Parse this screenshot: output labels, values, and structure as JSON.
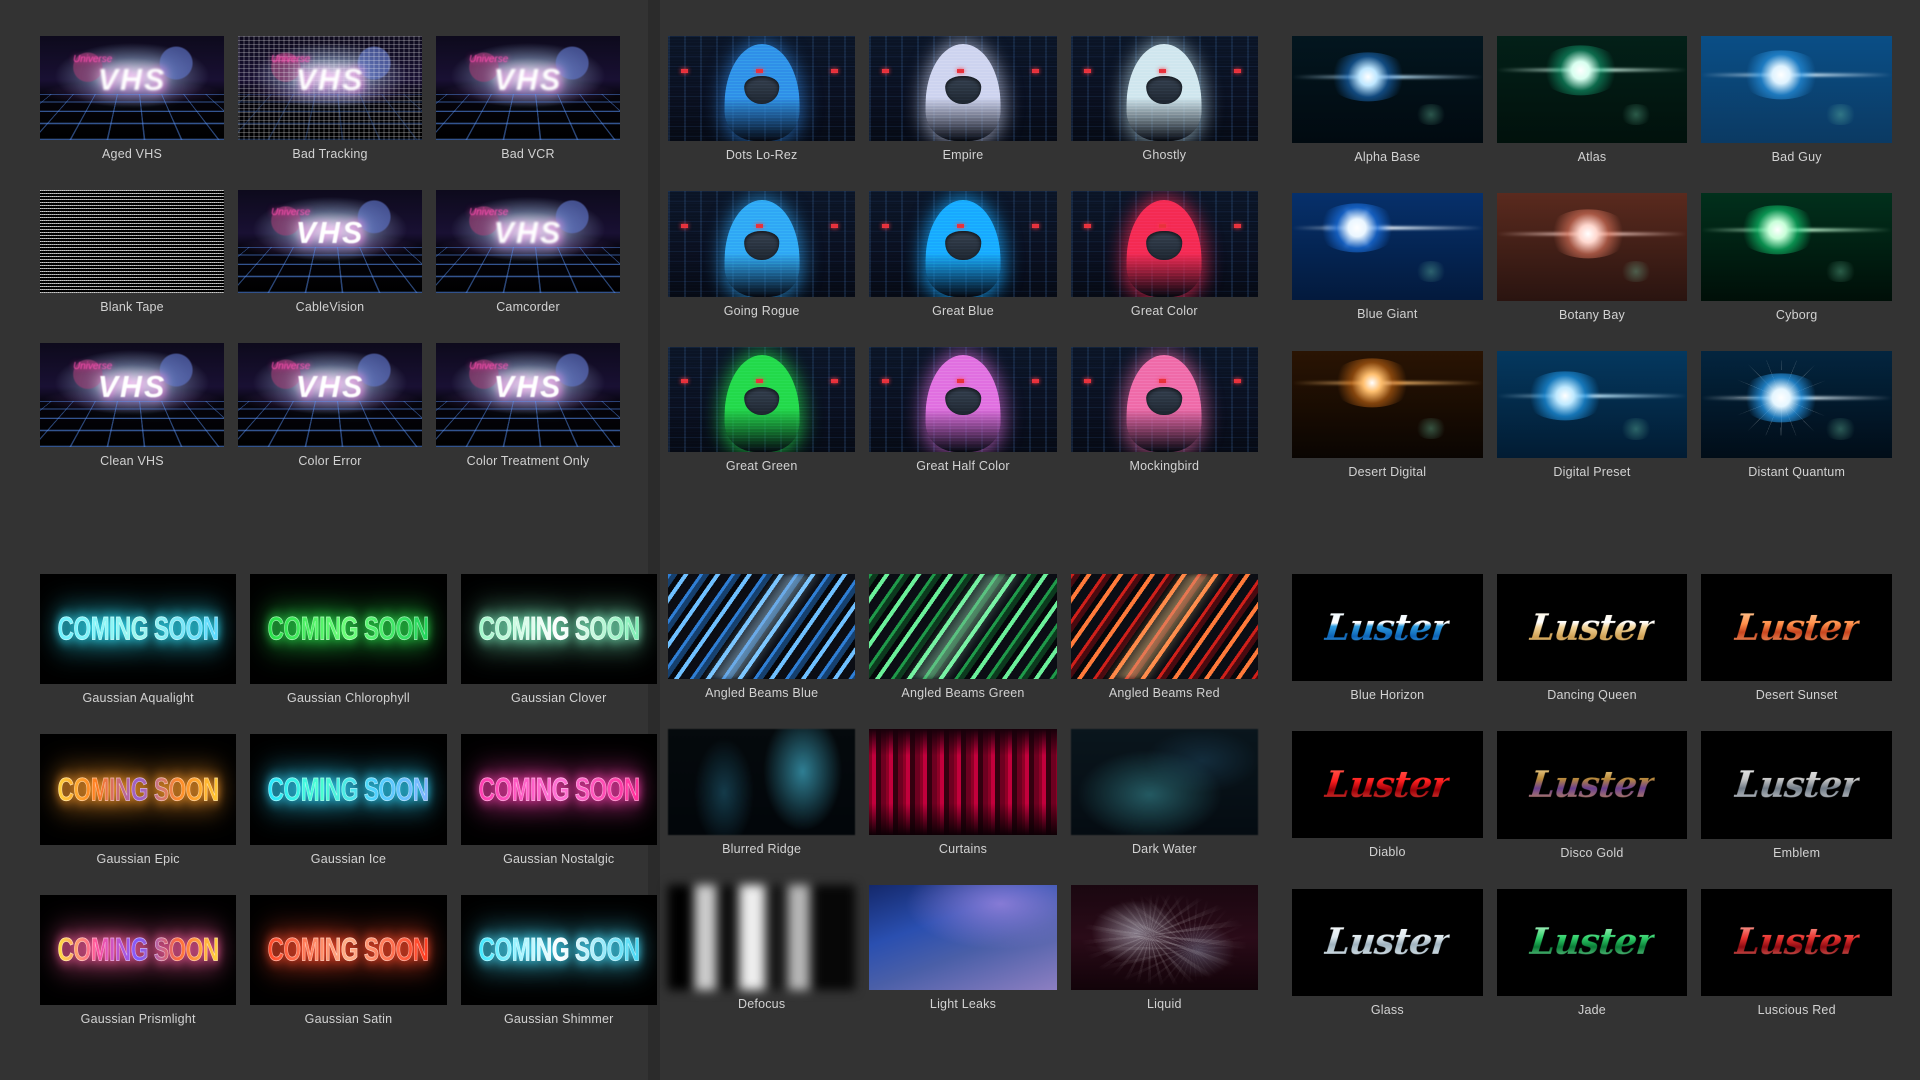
{
  "theme": {
    "app_background": "#2b2b2b",
    "panel_background": "#333333",
    "caption_color": "#d2d2d2",
    "thumbnail_background": "#000000"
  },
  "panels": [
    {
      "id": "vhs-presets",
      "band": "top",
      "column": 1,
      "items": [
        {
          "label": "Aged VHS",
          "art": "vhs",
          "variant": "aged"
        },
        {
          "label": "Bad Tracking",
          "art": "vhs",
          "variant": "tracking"
        },
        {
          "label": "Bad VCR",
          "art": "vhs",
          "variant": "badvcr"
        },
        {
          "label": "Blank Tape",
          "art": "vhs",
          "variant": "blank"
        },
        {
          "label": "CableVision",
          "art": "vhs",
          "variant": "cable"
        },
        {
          "label": "Camcorder",
          "art": "vhs",
          "variant": "camcorder"
        },
        {
          "label": "Clean VHS",
          "art": "vhs",
          "variant": "clean"
        },
        {
          "label": "Color Error",
          "art": "vhs",
          "variant": "colorerror"
        },
        {
          "label": "Color Treatment Only",
          "art": "vhs",
          "variant": "colortreat"
        }
      ]
    },
    {
      "id": "scifi-looks",
      "band": "top",
      "column": 2,
      "items": [
        {
          "label": "Dots Lo-Rez",
          "art": "scifi",
          "fg": "#2f8fe8",
          "glow": "rgba(50,140,235,0.55)"
        },
        {
          "label": "Empire",
          "art": "scifi",
          "fg": "#cdd3ef",
          "glow": "rgba(205,211,239,0.60)"
        },
        {
          "label": "Ghostly",
          "art": "scifi",
          "fg": "#cfe6ee",
          "glow": "rgba(200,235,245,0.55)"
        },
        {
          "label": "Going Rogue",
          "art": "scifi",
          "fg": "#2fa7f5",
          "glow": "rgba(47,167,245,0.60)"
        },
        {
          "label": "Great Blue",
          "art": "scifi",
          "fg": "#18a9ff",
          "glow": "rgba(24,169,255,0.70)"
        },
        {
          "label": "Great Color",
          "art": "scifi",
          "fg": "#f42a52",
          "glow": "rgba(244,42,82,0.65)"
        },
        {
          "label": "Great Green",
          "art": "scifi",
          "fg": "#23d94a",
          "glow": "rgba(35,217,74,0.65)"
        },
        {
          "label": "Great Half Color",
          "art": "scifi",
          "fg": "#e06fe0",
          "glow": "rgba(224,111,224,0.60)"
        },
        {
          "label": "Mockingbird",
          "art": "scifi",
          "fg": "#ef6aa8",
          "glow": "rgba(239,106,168,0.60)"
        }
      ]
    },
    {
      "id": "lens-flares",
      "band": "top",
      "column": 3,
      "items": [
        {
          "label": "Alpha Base",
          "art": "flare",
          "style": "soft",
          "c1": "#bfe7ff",
          "c2": "rgba(30,120,210,0.55)",
          "fx": "40%",
          "fy": "38%",
          "bg": "linear-gradient(#03161f,#010a10)"
        },
        {
          "label": "Atlas",
          "art": "flare",
          "style": "soft",
          "c1": "#d9fff0",
          "c2": "rgba(20,170,120,0.55)",
          "fx": "44%",
          "fy": "32%",
          "bg": "linear-gradient(#032018,#01110c)"
        },
        {
          "label": "Bad Guy",
          "art": "flare",
          "style": "soft",
          "c1": "#dff3ff",
          "c2": "rgba(40,150,230,0.65)",
          "fx": "42%",
          "fy": "36%",
          "bg": "linear-gradient(#0a4e86,#0b3a63)"
        },
        {
          "label": "Blue Giant",
          "art": "flare",
          "style": "star",
          "c1": "#eaf6ff",
          "c2": "rgba(25,110,220,0.75)",
          "fx": "34%",
          "fy": "32%",
          "bg": "linear-gradient(#06306b,#031a3d)"
        },
        {
          "label": "Botany Bay",
          "art": "flare",
          "style": "soft",
          "c1": "#ffd8cf",
          "c2": "rgba(225,120,95,0.60)",
          "fx": "48%",
          "fy": "38%",
          "bg": "linear-gradient(#5a2a1e,#2a1410)"
        },
        {
          "label": "Cyborg",
          "art": "flare",
          "style": "soft",
          "c1": "#c8ffd9",
          "c2": "rgba(15,200,110,0.65)",
          "fx": "40%",
          "fy": "34%",
          "bg": "linear-gradient(#01301c,#000f08)"
        },
        {
          "label": "Desert Digital",
          "art": "flare",
          "style": "soft",
          "c1": "#ffc070",
          "c2": "rgba(200,105,20,0.60)",
          "fx": "42%",
          "fy": "30%",
          "bg": "linear-gradient(#2a1403,#0a0502)"
        },
        {
          "label": "Digital Preset",
          "art": "flare",
          "style": "soft",
          "c1": "#bfe9ff",
          "c2": "rgba(30,150,230,0.70)",
          "fx": "36%",
          "fy": "42%",
          "bg": "linear-gradient(#04385f,#021c33)"
        },
        {
          "label": "Distant Quantum",
          "art": "flare",
          "style": "rays",
          "c1": "#e5f6ff",
          "c2": "rgba(40,160,245,0.70)",
          "fx": "42%",
          "fy": "44%",
          "bg": "linear-gradient(#03253f,#010d18)"
        }
      ]
    },
    {
      "id": "gaussian-text-looks",
      "band": "bottom",
      "column": 1,
      "sample_text": "COMING SOON",
      "items": [
        {
          "label": "Gaussian Aqualight",
          "art": "neon",
          "gradient": "linear-gradient(90deg,#6ef2ff,#9ef8f0,#5bd9ff)",
          "glow": "#2fe6ff"
        },
        {
          "label": "Gaussian Chlorophyll",
          "art": "neon",
          "gradient": "linear-gradient(90deg,#28e04a,#6dff7a,#1fd45a)",
          "glow": "#2ae24d"
        },
        {
          "label": "Gaussian Clover",
          "art": "neon",
          "gradient": "linear-gradient(90deg,#9ff7c9,#ffffff,#7df0b4)",
          "glow": "#7df0c0"
        },
        {
          "label": "Gaussian Epic",
          "art": "neon",
          "gradient": "linear-gradient(90deg,#ffd23d,#ff7a1f,#9a5fd0,#ff8a2a,#ffc832)",
          "glow": "#ff9b2a"
        },
        {
          "label": "Gaussian Ice",
          "art": "neon",
          "gradient": "linear-gradient(90deg,#29e6ff,#4affd0,#4fd2ff,#7fb4ff)",
          "glow": "#2fd8ff"
        },
        {
          "label": "Gaussian Nostalgic",
          "art": "neon",
          "gradient": "linear-gradient(90deg,#ff3fb0,#ff74d6,#ff2f9a)",
          "glow": "#ff3fb0"
        },
        {
          "label": "Gaussian Prismlight",
          "art": "neon",
          "gradient": "linear-gradient(90deg,#ffe23d,#ff4fa0,#7f5bff,#ff6a3d,#ffd23d)",
          "glow": "#ff5fa0"
        },
        {
          "label": "Gaussian Satin",
          "art": "neon",
          "gradient": "linear-gradient(90deg,#ff4a2a,#ffb08a,#ff3b1f)",
          "glow": "#ff4a2a"
        },
        {
          "label": "Gaussian Shimmer",
          "art": "neon",
          "gradient": "linear-gradient(90deg,#3fe8ff,#ffffff,#46d9f5)",
          "glow": "#46e0ff"
        }
      ]
    },
    {
      "id": "backgrounds-textures",
      "band": "bottom",
      "column": 2,
      "items": [
        {
          "label": "Angled Beams Blue",
          "art": "beams",
          "b1": "#2f7fd6",
          "b2": "#16406e",
          "b3": "#6fc0ff",
          "hot": "rgba(180,225,255,0.5)"
        },
        {
          "label": "Angled Beams Green",
          "art": "beams",
          "b1": "#1f9a4a",
          "b2": "#0c3a1e",
          "b3": "#6bf09a",
          "hot": "rgba(180,255,210,0.45)"
        },
        {
          "label": "Angled Beams Red",
          "art": "beams",
          "b1": "#d0201a",
          "b2": "#4a0a10",
          "b3": "#ff7a3a",
          "hot": "rgba(255,210,140,0.55)"
        },
        {
          "label": "Blurred Ridge",
          "art": "blurred-ridge"
        },
        {
          "label": "Curtains",
          "art": "curtains"
        },
        {
          "label": "Dark Water",
          "art": "dark-water"
        },
        {
          "label": "Defocus",
          "art": "defocus"
        },
        {
          "label": "Light Leaks",
          "art": "light-leaks"
        },
        {
          "label": "Liquid",
          "art": "liquid"
        }
      ]
    },
    {
      "id": "luster-title-styles",
      "band": "bottom",
      "column": 3,
      "sample_text": "Luster",
      "items": [
        {
          "label": "Blue Horizon",
          "art": "luster",
          "gradient": "linear-gradient(180deg,#e8f7ff 0%,#ffffff 38%,#2f9de0 46%,#0d63b6 70%,#5fc2ff 100%)"
        },
        {
          "label": "Dancing Queen",
          "art": "luster",
          "gradient": "linear-gradient(180deg,#fff4dc 0%,#ffffff 36%,#f2d49a 48%,#cf9f52 72%,#ffe9bd 100%)"
        },
        {
          "label": "Desert Sunset",
          "art": "luster",
          "gradient": "linear-gradient(180deg,#ffd7a8 0%,#ff8f4a 40%,#c7451f 60%,#ffb177 100%)"
        },
        {
          "label": "Diablo",
          "art": "luster",
          "gradient": "linear-gradient(180deg,#ff6a5a 0%,#ff1f1f 40%,#9a0008 62%,#ff5a4a 100%)"
        },
        {
          "label": "Disco Gold",
          "art": "luster",
          "gradient": "linear-gradient(180deg,#ffe7a8 0%,#b98a3a 35%,#6a3f8f 58%,#e0a84a 100%)"
        },
        {
          "label": "Emblem",
          "art": "luster",
          "gradient": "linear-gradient(180deg,#f2f2f2 0%,#c8c8c8 36%,#6f7a86 58%,#e8e8e8 100%)"
        },
        {
          "label": "Glass",
          "art": "luster",
          "gradient": "linear-gradient(180deg,#ffffff 0%,#dfe9ef 38%,#9fb3bf 56%,#f4fbff 100%)"
        },
        {
          "label": "Jade",
          "art": "luster",
          "gradient": "linear-gradient(180deg,#d6ffe0 0%,#2fcf6a 40%,#0a7a36 62%,#8df0b0 100%)"
        },
        {
          "label": "Luscious Red",
          "art": "luster",
          "gradient": "linear-gradient(180deg,#ffbdb0 0%,#e8332f 40%,#8e0b12 62%,#ff8a7a 100%)"
        }
      ]
    }
  ]
}
